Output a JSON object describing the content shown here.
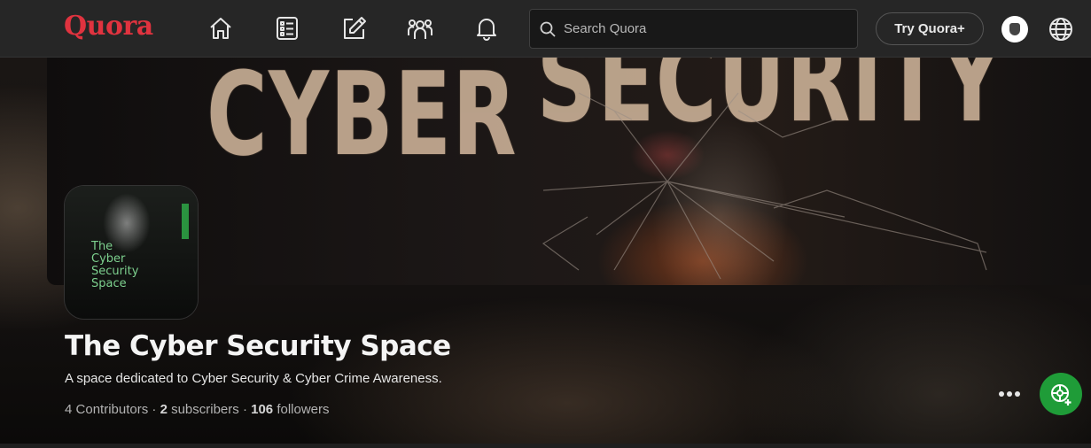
{
  "header": {
    "logo": "Quora",
    "nav_icons": [
      "home-icon",
      "following-icon",
      "answer-icon",
      "spaces-icon",
      "notifications-icon"
    ],
    "search_placeholder": "Search Quora",
    "try_plus_label": "Try Quora+"
  },
  "cover": {
    "banner_text_line1": "CYBER",
    "banner_text_line2": "SECURITY"
  },
  "space": {
    "icon_text": [
      "The",
      "Cyber",
      "Security",
      "Space"
    ],
    "title": "The Cyber Security Space",
    "description": "A space dedicated to Cyber Security & Cyber Crime Awareness.",
    "contributors_count": "4",
    "contributors_label": "Contributors",
    "subscribers_count": "2",
    "subscribers_label": "subscribers",
    "followers_count": "106",
    "followers_label": "followers",
    "separator": "·"
  },
  "colors": {
    "brand": "#e0333f",
    "follow_button": "#1f9c38",
    "topbar": "#262626"
  }
}
